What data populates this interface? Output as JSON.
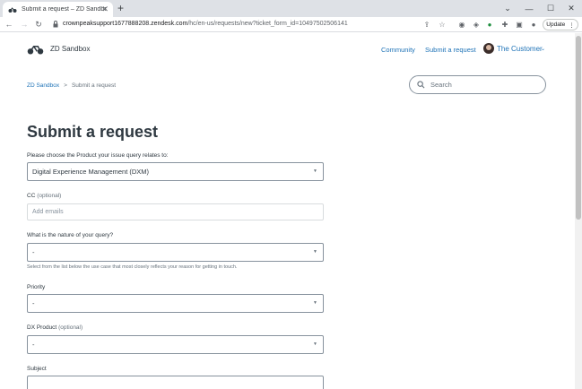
{
  "browser": {
    "tab_title": "Submit a request – ZD Sandbox",
    "tab_close": "✕",
    "new_tab": "+",
    "url_main": "crownpeaksupport1677888208.zendesk.com",
    "url_rest": "/hc/en-us/requests/new?ticket_form_id=10497502506141",
    "update_label": "Update",
    "win_minimize": "⌄",
    "win_min": "—",
    "win_max": "☐",
    "win_close": "✕"
  },
  "site": {
    "brand": "ZD Sandbox",
    "nav": {
      "community": "Community",
      "submit": "Submit a request"
    },
    "user_name": "The Customer",
    "user_caret": "⌄"
  },
  "breadcrumb": {
    "home": "ZD Sandbox",
    "separator": ">",
    "current": "Submit a request"
  },
  "search": {
    "placeholder": "Search"
  },
  "form": {
    "title": "Submit a request",
    "product": {
      "label": "Please choose the Product your issue query relates to:",
      "value": "Digital Experience Management (DXM)"
    },
    "cc": {
      "label": "CC",
      "optional": "(optional)",
      "placeholder": "Add emails"
    },
    "nature": {
      "label": "What is the nature of your query?",
      "value": "-",
      "hint": "Select from the list below the use case that most closely reflects your reason for getting in touch."
    },
    "priority": {
      "label": "Priority",
      "value": "-"
    },
    "dx_product": {
      "label": "DX Product",
      "optional": "(optional)",
      "value": "-"
    },
    "subject": {
      "label": "Subject"
    },
    "select_arrow": "▼"
  },
  "colors": {
    "link": "#1f73b7",
    "text": "#2f3941",
    "muted": "#68737d",
    "border": "#87929d"
  }
}
